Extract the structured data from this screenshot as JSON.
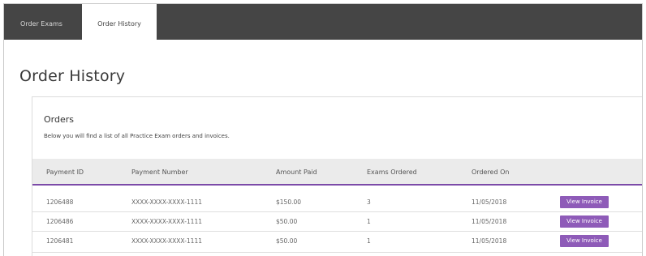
{
  "tabs": [
    {
      "label": "Order Exams"
    },
    {
      "label": "Order History"
    }
  ],
  "page_title": "Order History",
  "orders": {
    "title": "Orders",
    "description": "Below you will find a list of all Practice Exam orders and invoices.",
    "columns": [
      "Payment ID",
      "Payment Number",
      "Amount Paid",
      "Exams Ordered",
      "Ordered On"
    ],
    "rows": [
      {
        "payment_id": "1206488",
        "payment_number": "XXXX-XXXX-XXXX-1111",
        "amount_paid": "$150.00",
        "exams_ordered": "3",
        "ordered_on": "11/05/2018",
        "action": "View Invoice"
      },
      {
        "payment_id": "1206486",
        "payment_number": "XXXX-XXXX-XXXX-1111",
        "amount_paid": "$50.00",
        "exams_ordered": "1",
        "ordered_on": "11/05/2018",
        "action": "View Invoice"
      },
      {
        "payment_id": "1206481",
        "payment_number": "XXXX-XXXX-XXXX-1111",
        "amount_paid": "$50.00",
        "exams_ordered": "1",
        "ordered_on": "11/05/2018",
        "action": "View Invoice"
      }
    ]
  },
  "colors": {
    "tabbar": "#454545",
    "accent": "#8e5bb8",
    "header_border": "#7b4aa8"
  }
}
